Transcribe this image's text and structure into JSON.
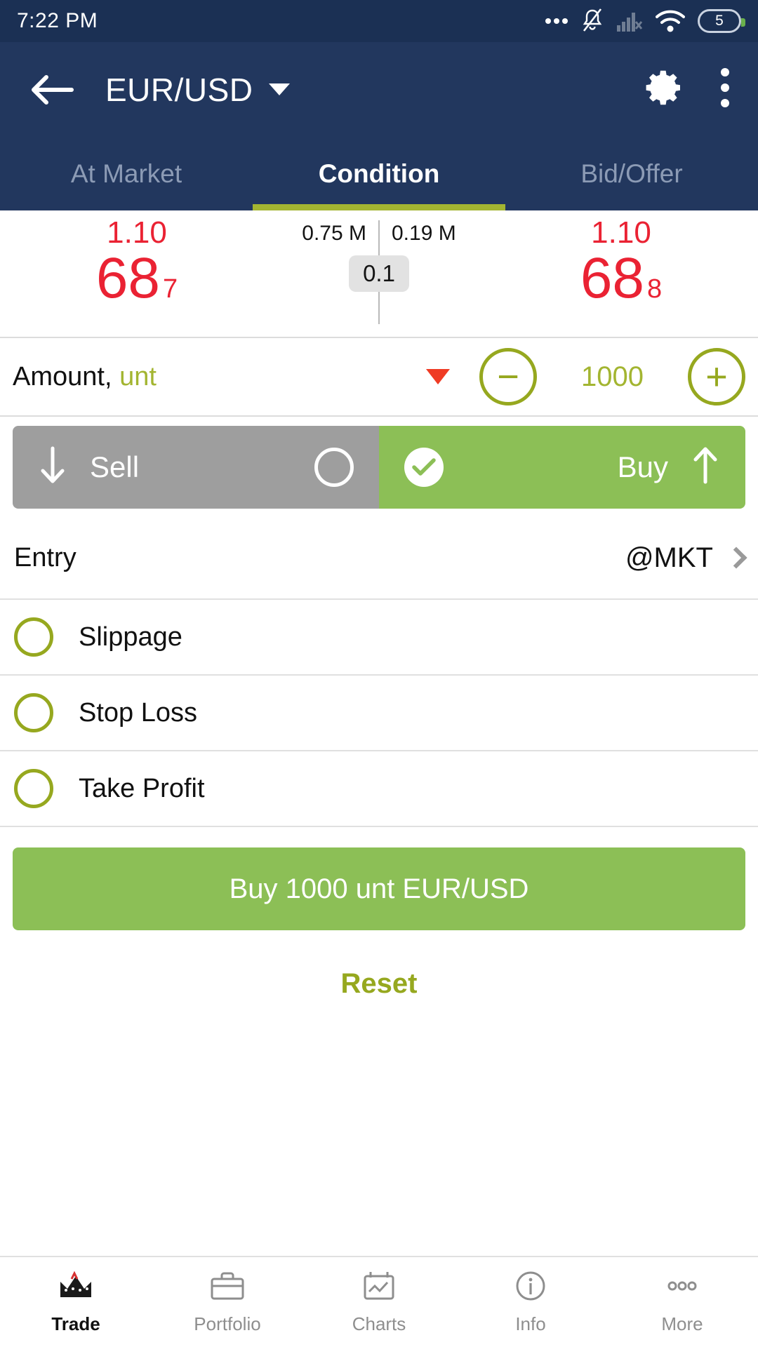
{
  "statusbar": {
    "time": "7:22 PM",
    "battery_level": "5",
    "icons": [
      "more-dots-icon",
      "bell-muted-icon",
      "signal-off-icon",
      "wifi-icon",
      "battery-icon"
    ]
  },
  "header": {
    "back_icon": "back-arrow-icon",
    "title": "EUR/USD",
    "dropdown_icon": "chevron-down-icon",
    "settings_icon": "gear-icon",
    "overflow_icon": "overflow-menu-icon"
  },
  "tabs": [
    {
      "label": "At Market",
      "active": false
    },
    {
      "label": "Condition",
      "active": true
    },
    {
      "label": "Bid/Offer",
      "active": false
    }
  ],
  "quote": {
    "bid": {
      "prefix": "1.10",
      "main": "68",
      "sub": "7",
      "volume": "0.75 M"
    },
    "ask": {
      "prefix": "1.10",
      "main": "68",
      "sub": "8",
      "volume": "0.19 M"
    },
    "spread": "0.1"
  },
  "amount": {
    "label": "Amount,",
    "unit": "unt",
    "value": "1000",
    "decrement_label": "−",
    "increment_label": "+"
  },
  "direction": {
    "sell_label": "Sell",
    "buy_label": "Buy",
    "selected": "Buy"
  },
  "entry": {
    "label": "Entry",
    "value": "@MKT"
  },
  "options": [
    {
      "label": "Slippage",
      "checked": false
    },
    {
      "label": "Stop Loss",
      "checked": false
    },
    {
      "label": "Take Profit",
      "checked": false
    }
  ],
  "actions": {
    "submit_label": "Buy 1000 unt EUR/USD",
    "reset_label": "Reset"
  },
  "bottomnav": [
    {
      "label": "Trade",
      "icon": "candlestick-crown-icon",
      "active": true
    },
    {
      "label": "Portfolio",
      "icon": "briefcase-icon",
      "active": false
    },
    {
      "label": "Charts",
      "icon": "chart-icon",
      "active": false
    },
    {
      "label": "Info",
      "icon": "info-circle-icon",
      "active": false
    },
    {
      "label": "More",
      "icon": "more-dots-icon",
      "active": false
    }
  ],
  "colors": {
    "header_bg": "#22375e",
    "statusbar_bg": "#1b3054",
    "accent_olive": "#a3b531",
    "buy_green": "#8cbf56",
    "sell_gray": "#9e9e9e",
    "price_red": "#ea2233"
  }
}
